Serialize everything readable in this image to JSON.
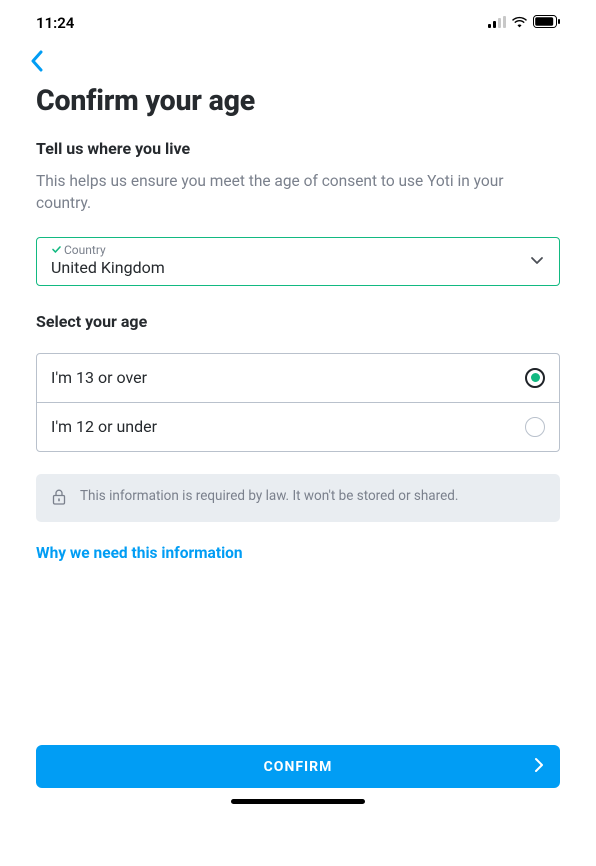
{
  "status_bar": {
    "time": "11:24"
  },
  "header": {
    "title": "Confirm your age"
  },
  "location_section": {
    "heading": "Tell us where you live",
    "body": "This helps us ensure you meet the age of consent to use Yoti in your country.",
    "label": "Country",
    "value": "United Kingdom"
  },
  "age_section": {
    "heading": "Select your age",
    "option_over": "I'm 13 or over",
    "option_under": "I'm 12 or under"
  },
  "info_box": {
    "text": "This information is required by law. It won't be stored or shared."
  },
  "link_text": "Why we need this information",
  "confirm_label": "CONFIRM"
}
